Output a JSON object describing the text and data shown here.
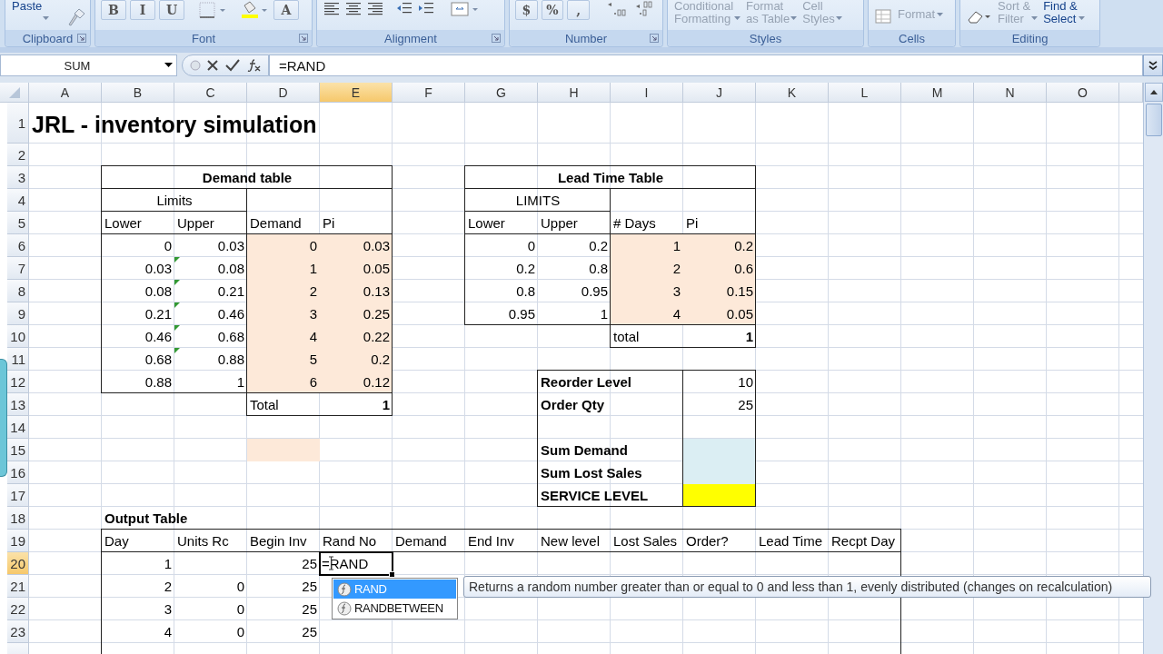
{
  "ribbon": {
    "groups": [
      {
        "label": "Clipboard",
        "launcher": true,
        "items": [
          {
            "kind": "big",
            "lines": [
              "Paste"
            ],
            "disabled": false
          }
        ]
      },
      {
        "label": "Font",
        "launcher": true,
        "items": [
          {
            "kind": "glyph",
            "label": "B",
            "disabled": false
          },
          {
            "kind": "glyph",
            "label": "I",
            "disabled": false
          },
          {
            "kind": "glyph",
            "label": "U",
            "disabled": false
          },
          {
            "kind": "glyph",
            "label": "A",
            "disabled": false
          }
        ]
      },
      {
        "label": "Alignment",
        "launcher": true
      },
      {
        "label": "Number",
        "launcher": true,
        "items": [
          {
            "kind": "glyph",
            "label": "$",
            "disabled": false
          },
          {
            "kind": "glyph",
            "label": "%",
            "disabled": false
          },
          {
            "kind": "glyph",
            "label": ",",
            "disabled": false
          }
        ]
      },
      {
        "label": "Styles",
        "launcher": false,
        "items": [
          {
            "kind": "big",
            "lines": [
              "Conditional",
              "Formatting"
            ],
            "disabled": true
          },
          {
            "kind": "big",
            "lines": [
              "Format",
              "as Table"
            ],
            "disabled": true
          },
          {
            "kind": "big",
            "lines": [
              "Cell",
              "Styles"
            ],
            "disabled": true
          }
        ]
      },
      {
        "label": "Cells",
        "launcher": false,
        "items": [
          {
            "kind": "small",
            "lines": [
              "Format"
            ],
            "disabled": true
          }
        ]
      },
      {
        "label": "Editing",
        "launcher": false,
        "items": [
          {
            "kind": "big",
            "lines": [
              "Sort &",
              "Filter"
            ],
            "disabled": true
          },
          {
            "kind": "big",
            "lines": [
              "Find &",
              "Select"
            ],
            "disabled": false
          }
        ]
      }
    ]
  },
  "formula_bar": {
    "name_box": "SUM",
    "formula": "=RAND"
  },
  "sheet": {
    "columns": [
      {
        "label": "A",
        "selected": false
      },
      {
        "label": "B",
        "selected": false
      },
      {
        "label": "C",
        "selected": false
      },
      {
        "label": "D",
        "selected": false
      },
      {
        "label": "E",
        "selected": true
      },
      {
        "label": "F",
        "selected": false
      },
      {
        "label": "G",
        "selected": false
      },
      {
        "label": "H",
        "selected": false
      },
      {
        "label": "I",
        "selected": false
      },
      {
        "label": "J",
        "selected": false
      },
      {
        "label": "K",
        "selected": false
      },
      {
        "label": "L",
        "selected": false
      },
      {
        "label": "M",
        "selected": false
      },
      {
        "label": "N",
        "selected": false
      },
      {
        "label": "O",
        "selected": false
      }
    ],
    "rows": [
      {
        "label": "1",
        "selected": false,
        "cells": [
          {
            "text": "JRL - inventory simulation",
            "kind": "title"
          }
        ]
      },
      {
        "label": "2",
        "selected": false
      },
      {
        "label": "3",
        "selected": false,
        "cells": [
          "",
          {
            "text": "Demand table",
            "kind": "heading",
            "bold": true
          },
          "",
          "",
          "",
          "",
          {
            "text": "Lead Time Table",
            "kind": "heading",
            "bold": true
          }
        ]
      },
      {
        "label": "4",
        "selected": false,
        "cells": [
          "",
          {
            "text": "Limits",
            "kind": "heading"
          },
          "",
          "",
          "",
          "",
          {
            "text": "LIMITS",
            "kind": "heading"
          }
        ]
      },
      {
        "label": "5",
        "selected": false,
        "cells": [
          "",
          "Lower",
          "Upper",
          "Demand",
          "Pi",
          "",
          "Lower",
          "Upper",
          "# Days",
          "Pi"
        ]
      },
      {
        "label": "6",
        "selected": false,
        "cells": [
          "",
          {
            "text": "0",
            "kind": "number"
          },
          {
            "text": "0.03",
            "kind": "number"
          },
          {
            "text": "0",
            "kind": "number",
            "color": "#fde9d9"
          },
          {
            "text": "0.03",
            "kind": "number",
            "color": "#fde9d9"
          },
          "",
          {
            "text": "0",
            "kind": "number"
          },
          {
            "text": "0.2",
            "kind": "number"
          },
          {
            "text": "1",
            "kind": "number",
            "color": "#fde9d9"
          },
          {
            "text": "0.2",
            "kind": "number",
            "color": "#fde9d9"
          }
        ]
      },
      {
        "label": "7",
        "selected": false,
        "cells": [
          "",
          {
            "text": "0.03",
            "kind": "number"
          },
          {
            "text": "0.08",
            "kind": "number",
            "warning": true
          },
          {
            "text": "1",
            "kind": "number",
            "color": "#fde9d9"
          },
          {
            "text": "0.05",
            "kind": "number",
            "color": "#fde9d9"
          },
          "",
          {
            "text": "0.2",
            "kind": "number"
          },
          {
            "text": "0.8",
            "kind": "number"
          },
          {
            "text": "2",
            "kind": "number",
            "color": "#fde9d9"
          },
          {
            "text": "0.6",
            "kind": "number",
            "color": "#fde9d9"
          }
        ]
      },
      {
        "label": "8",
        "selected": false,
        "cells": [
          "",
          {
            "text": "0.08",
            "kind": "number"
          },
          {
            "text": "0.21",
            "kind": "number",
            "warning": true
          },
          {
            "text": "2",
            "kind": "number",
            "color": "#fde9d9"
          },
          {
            "text": "0.13",
            "kind": "number",
            "color": "#fde9d9"
          },
          "",
          {
            "text": "0.8",
            "kind": "number"
          },
          {
            "text": "0.95",
            "kind": "number"
          },
          {
            "text": "3",
            "kind": "number",
            "color": "#fde9d9"
          },
          {
            "text": "0.15",
            "kind": "number",
            "color": "#fde9d9"
          }
        ]
      },
      {
        "label": "9",
        "selected": false,
        "cells": [
          "",
          {
            "text": "0.21",
            "kind": "number"
          },
          {
            "text": "0.46",
            "kind": "number",
            "warning": true
          },
          {
            "text": "3",
            "kind": "number",
            "color": "#fde9d9"
          },
          {
            "text": "0.25",
            "kind": "number",
            "color": "#fde9d9"
          },
          "",
          {
            "text": "0.95",
            "kind": "number"
          },
          {
            "text": "1",
            "kind": "number"
          },
          {
            "text": "4",
            "kind": "number",
            "color": "#fde9d9"
          },
          {
            "text": "0.05",
            "kind": "number",
            "color": "#fde9d9"
          }
        ]
      },
      {
        "label": "10",
        "selected": false,
        "cells": [
          "",
          {
            "text": "0.46",
            "kind": "number"
          },
          {
            "text": "0.68",
            "kind": "number",
            "warning": true
          },
          {
            "text": "4",
            "kind": "number",
            "color": "#fde9d9"
          },
          {
            "text": "0.22",
            "kind": "number",
            "color": "#fde9d9"
          },
          "",
          "",
          "",
          "total",
          {
            "text": "1",
            "kind": "number",
            "bold": true
          }
        ]
      },
      {
        "label": "11",
        "selected": false,
        "cells": [
          "",
          {
            "text": "0.68",
            "kind": "number"
          },
          {
            "text": "0.88",
            "kind": "number",
            "warning": true
          },
          {
            "text": "5",
            "kind": "number",
            "color": "#fde9d9"
          },
          {
            "text": "0.2",
            "kind": "number",
            "color": "#fde9d9"
          }
        ]
      },
      {
        "label": "12",
        "selected": false,
        "cells": [
          "",
          {
            "text": "0.88",
            "kind": "number"
          },
          {
            "text": "1",
            "kind": "number"
          },
          {
            "text": "6",
            "kind": "number",
            "color": "#fde9d9"
          },
          {
            "text": "0.12",
            "kind": "number",
            "color": "#fde9d9"
          },
          "",
          "",
          {
            "text": "Reorder Level",
            "bold": true
          },
          "",
          {
            "text": "10",
            "kind": "number"
          }
        ]
      },
      {
        "label": "13",
        "selected": false,
        "cells": [
          "",
          "",
          "",
          "Total",
          {
            "text": "1",
            "kind": "number",
            "bold": true
          },
          "",
          "",
          {
            "text": "Order Qty",
            "bold": true
          },
          "",
          {
            "text": "25",
            "kind": "number"
          }
        ]
      },
      {
        "label": "14",
        "selected": false
      },
      {
        "label": "15",
        "selected": false,
        "cells": [
          "",
          "",
          "",
          {
            "color": "#fde9d9"
          },
          "",
          "",
          "",
          {
            "text": "Sum Demand",
            "bold": true
          },
          "",
          {
            "color": "#dbeef3"
          }
        ]
      },
      {
        "label": "16",
        "selected": false,
        "cells": [
          "",
          "",
          "",
          "",
          "",
          "",
          "",
          {
            "text": "Sum Lost Sales",
            "bold": true
          },
          "",
          {
            "color": "#dbeef3"
          }
        ]
      },
      {
        "label": "17",
        "selected": false,
        "cells": [
          "",
          "",
          "",
          "",
          "",
          "",
          "",
          {
            "text": "SERVICE LEVEL",
            "bold": true
          },
          "",
          {
            "color": "#ffff00"
          }
        ]
      },
      {
        "label": "18",
        "selected": false,
        "cells": [
          "",
          {
            "text": "Output Table",
            "bold": true
          }
        ]
      },
      {
        "label": "19",
        "selected": false,
        "cells": [
          "",
          "Day",
          "Units Rc",
          "Begin Inv",
          "Rand No",
          "Demand",
          "End Inv",
          "New level",
          "Lost Sales",
          "Order?",
          "Lead Time",
          "Recpt Day"
        ]
      },
      {
        "label": "20",
        "selected": true,
        "cells": [
          "",
          {
            "text": "1",
            "kind": "number"
          },
          "",
          {
            "text": "25",
            "kind": "number"
          },
          {
            "text": "=RAND",
            "active": true
          }
        ]
      },
      {
        "label": "21",
        "selected": false,
        "cells": [
          "",
          {
            "text": "2",
            "kind": "number"
          },
          {
            "text": "0",
            "kind": "number"
          },
          {
            "text": "25",
            "kind": "number"
          }
        ]
      },
      {
        "label": "22",
        "selected": false,
        "cells": [
          "",
          {
            "text": "3",
            "kind": "number"
          },
          {
            "text": "0",
            "kind": "number"
          },
          {
            "text": "25",
            "kind": "number"
          }
        ]
      },
      {
        "label": "23",
        "selected": false,
        "cells": [
          "",
          {
            "text": "4",
            "kind": "number"
          },
          {
            "text": "0",
            "kind": "number"
          },
          {
            "text": "25",
            "kind": "number"
          }
        ]
      }
    ]
  },
  "autocomplete": {
    "items": [
      {
        "label": "RAND",
        "selected": true
      },
      {
        "label": "RANDBETWEEN",
        "selected": false
      }
    ],
    "tooltip": "Returns a random number greater than or equal to 0 and less than 1, evenly distributed (changes on recalculation)"
  }
}
